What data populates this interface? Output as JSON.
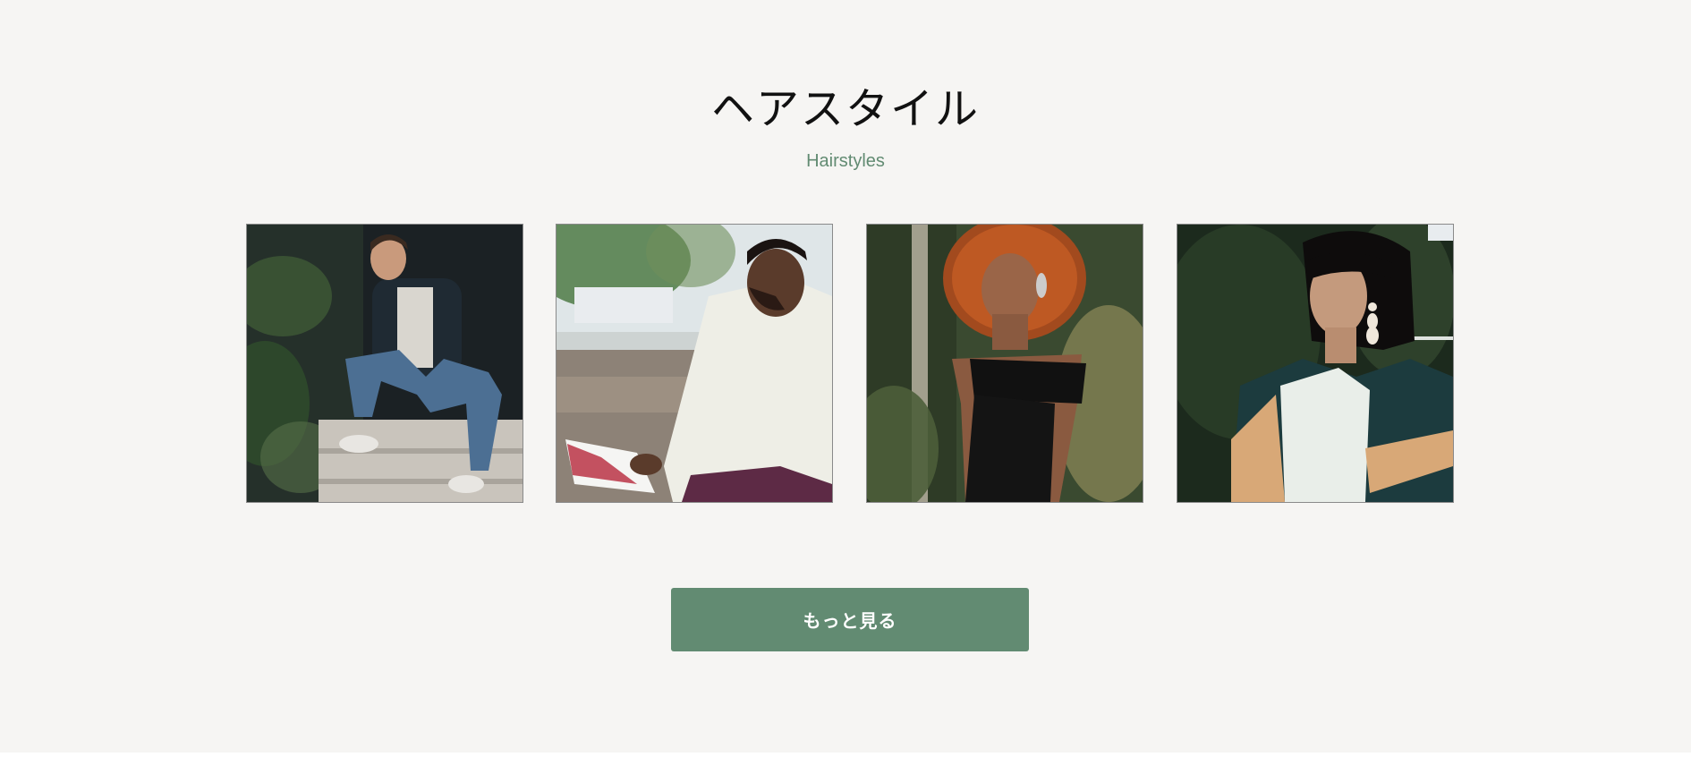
{
  "section": {
    "title": "ヘアスタイル",
    "subtitle": "Hairstyles",
    "accent_color": "#628b72",
    "background_color": "#f6f5f3"
  },
  "gallery": {
    "photos": [
      {
        "name": "man-sitting-on-steps-photo"
      },
      {
        "name": "man-reading-book-photo"
      },
      {
        "name": "woman-curly-hair-photo"
      },
      {
        "name": "woman-bob-earrings-photo"
      }
    ]
  },
  "actions": {
    "more_label": "もっと見る"
  }
}
